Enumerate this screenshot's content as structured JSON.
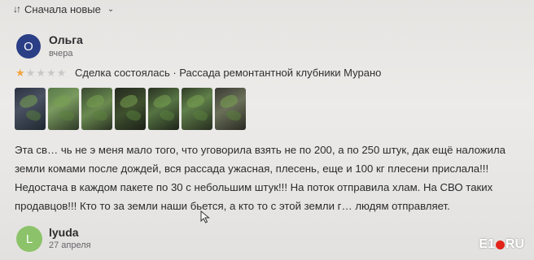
{
  "sort": {
    "icon": "sort-icon",
    "label": "Сначала новые",
    "chevron": "chevron-down-icon"
  },
  "reviews": [
    {
      "avatar_letter": "О",
      "avatar_color": "#2b3f86",
      "author": "Ольга",
      "date": "вчера",
      "rating": 1,
      "rating_max": 5,
      "deal_text": "Сделка состоялась · Рассада ремонтантной клубники Мурано",
      "photos_count": 7,
      "text_lines": [
        "Эта св… чь не э меня мало того, что уговорила взять не по 200, а по 250 штук, дак ещё наложила",
        "земли комами после дождей, вся рассада ужасная, плесень, еще и 100 кг плесени прислала!!!",
        "Недостача в каждом пакете по 30 с небольшим штук!!! На поток отправила хлам. На СВО таких",
        "продавцов!!! Кто то за земли наши бьется, а кто то с этой земли г… людям отправляет."
      ]
    },
    {
      "avatar_letter": "L",
      "avatar_color": "#8cc36a",
      "author": "lyuda",
      "date": "27 апреля"
    }
  ],
  "watermark": {
    "part1": "E1",
    "part2": "RU"
  },
  "colors": {
    "star_on": "#f2a540",
    "star_off": "#c9c8c6"
  }
}
